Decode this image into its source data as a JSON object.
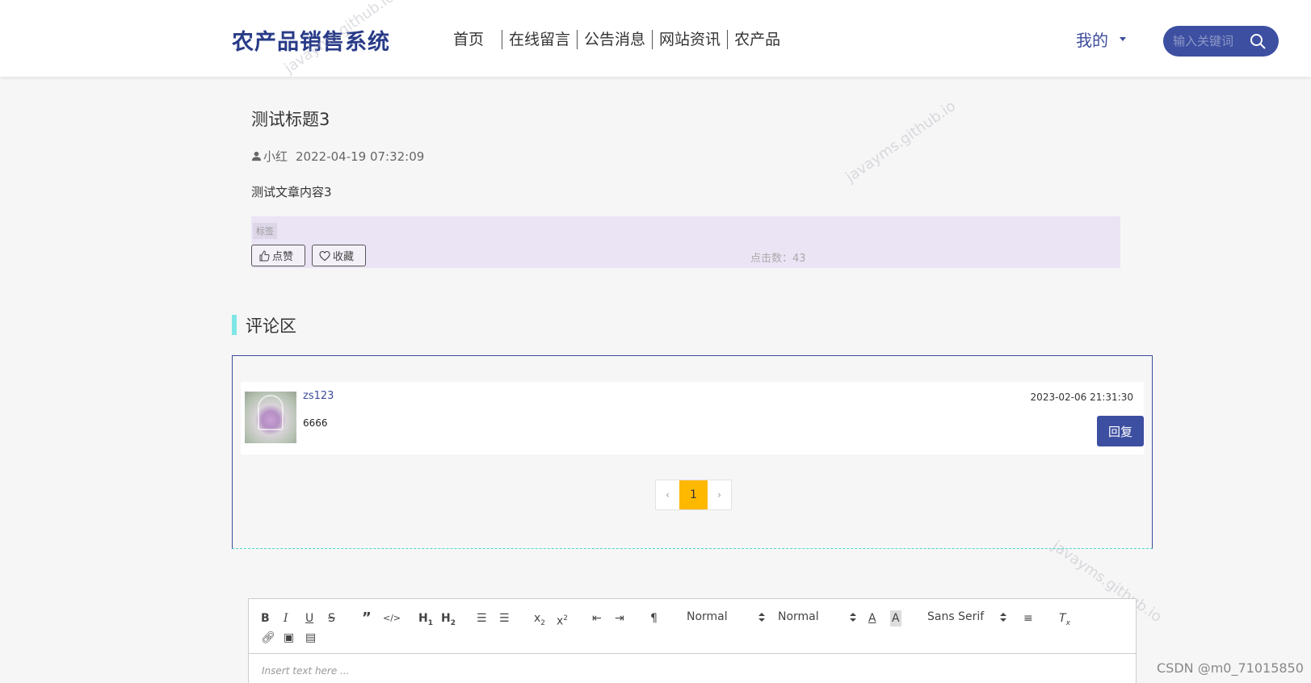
{
  "header": {
    "logo": "农产品销售系统",
    "nav": [
      "首页",
      "在线留言",
      "公告消息",
      "网站资讯",
      "农产品"
    ],
    "mine": "我的",
    "search_placeholder": "输入关键词"
  },
  "article": {
    "title": "测试标题3",
    "author": "小红",
    "date": "2022-04-19 07:32:09",
    "content": "测试文章内容3",
    "tag": "标签",
    "like_label": "点赞",
    "favorite_label": "收藏",
    "clicks_label": "点击数：43"
  },
  "comments": {
    "title": "评论区",
    "items": [
      {
        "user": "zs123",
        "text": "6666",
        "time": "2023-02-06 21:31:30",
        "reply_label": "回复"
      }
    ],
    "pagination": {
      "prev": "‹",
      "current": "1",
      "next": "›"
    }
  },
  "editor": {
    "header_select": "Normal",
    "size_select": "Normal",
    "font_select": "Sans Serif",
    "placeholder": "Insert text here ..."
  },
  "watermark": "javayms.github.io",
  "footer_credit": "CSDN @m0_71015850",
  "colors": {
    "primary": "#3d4fa1",
    "accent": "#7fe6e6",
    "page_active": "#ffb800",
    "tag_bg": "#ebe4f5"
  }
}
